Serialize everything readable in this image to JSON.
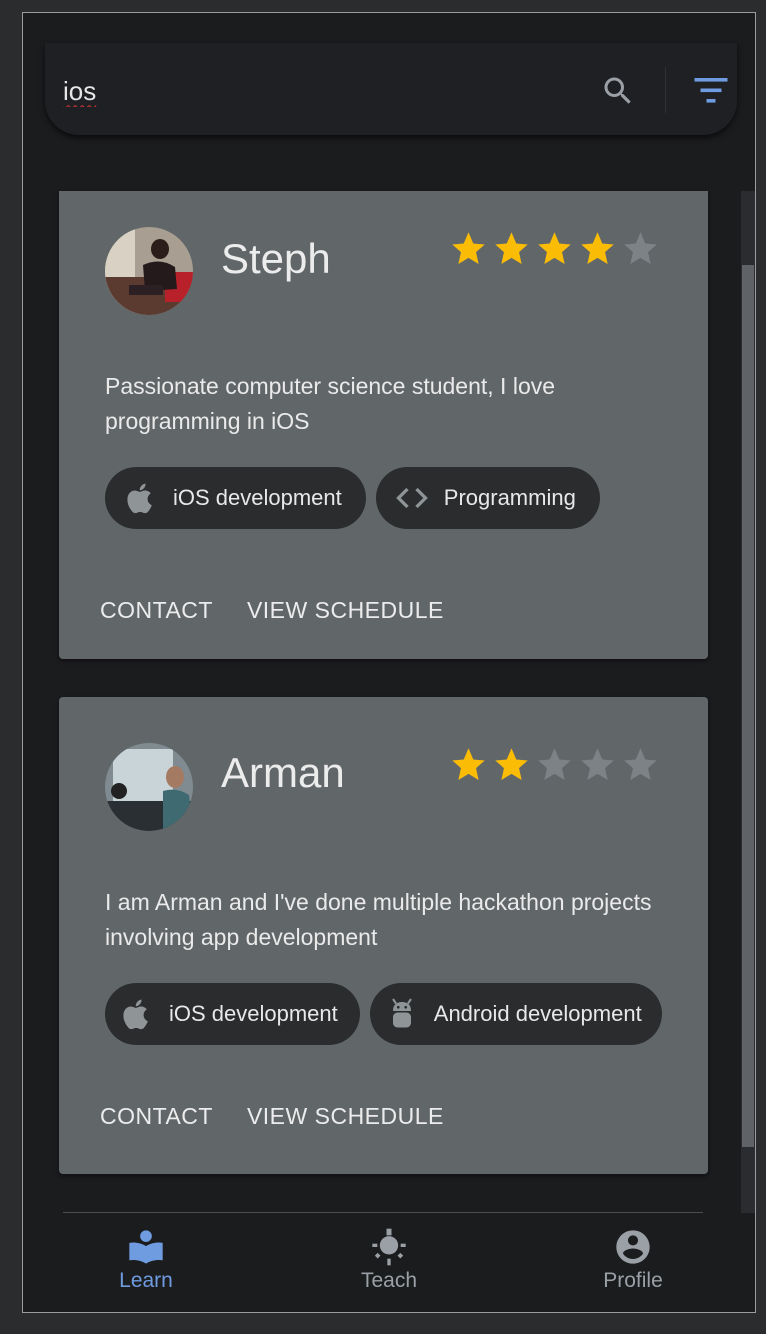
{
  "search": {
    "query": "ios",
    "search_icon": "search-icon",
    "filter_icon": "filter-icon"
  },
  "colors": {
    "accent": "#6f9be0",
    "star_filled": "#fbbc05",
    "star_empty": "#7d8286",
    "card_bg": "#616769",
    "chip_bg": "#2a2c2e"
  },
  "tutors": [
    {
      "name": "Steph",
      "rating": 4,
      "max_rating": 5,
      "bio": "Passionate computer science student, I love programming in iOS",
      "skills": [
        {
          "label": "iOS development",
          "icon": "apple-icon"
        },
        {
          "label": "Programming",
          "icon": "code-icon"
        }
      ],
      "actions": {
        "contact": "CONTACT",
        "schedule": "VIEW SCHEDULE"
      }
    },
    {
      "name": "Arman",
      "rating": 2,
      "max_rating": 5,
      "bio": "I am Arman and I've done multiple hackathon projects involving app development",
      "skills": [
        {
          "label": "iOS development",
          "icon": "apple-icon"
        },
        {
          "label": "Android development",
          "icon": "android-icon"
        }
      ],
      "actions": {
        "contact": "CONTACT",
        "schedule": "VIEW SCHEDULE"
      }
    }
  ],
  "nav": {
    "items": [
      {
        "label": "Learn",
        "icon": "learn-icon",
        "active": true
      },
      {
        "label": "Teach",
        "icon": "teach-icon",
        "active": false
      },
      {
        "label": "Profile",
        "icon": "profile-icon",
        "active": false
      }
    ]
  }
}
